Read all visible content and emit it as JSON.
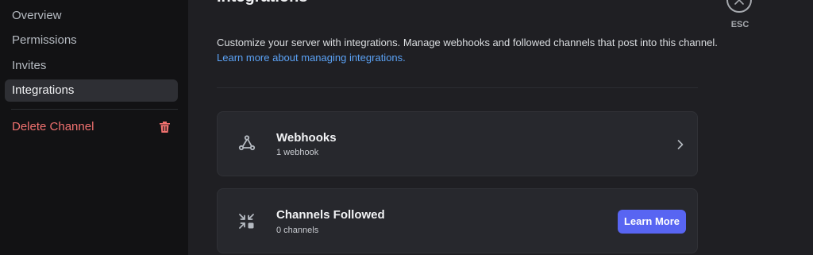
{
  "sidebar": {
    "items": [
      {
        "label": "Overview"
      },
      {
        "label": "Permissions"
      },
      {
        "label": "Invites"
      },
      {
        "label": "Integrations"
      }
    ],
    "delete_label": "Delete Channel"
  },
  "page": {
    "title": "Integrations",
    "description": "Customize your server with integrations. Manage webhooks and followed channels that post into this channel.",
    "learn_link": "Learn more about managing integrations."
  },
  "cards": {
    "webhooks": {
      "title": "Webhooks",
      "subtitle": "1 webhook",
      "icon": "webhook-icon"
    },
    "channels_followed": {
      "title": "Channels Followed",
      "subtitle": "0 channels",
      "icon": "channels-followed-icon",
      "button_label": "Learn More"
    }
  },
  "close": {
    "label": "ESC"
  },
  "colors": {
    "accent": "#5865f2",
    "link": "#5ba2f5",
    "danger": "#f0716f"
  }
}
